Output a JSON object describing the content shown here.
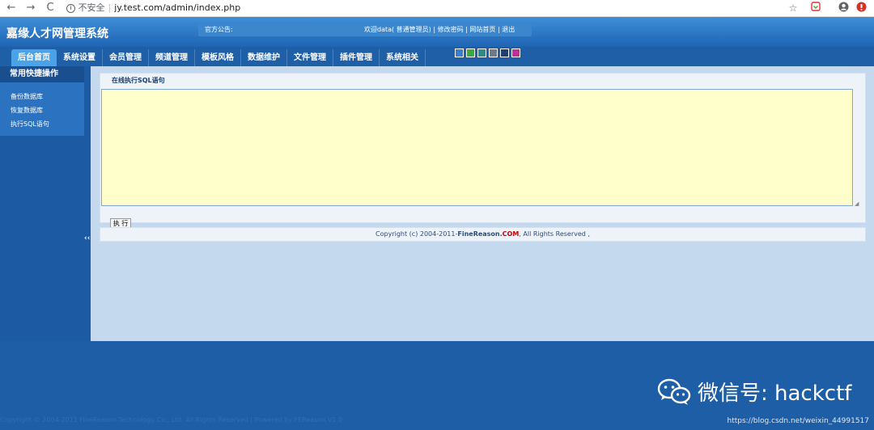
{
  "browser": {
    "back_icon": "←",
    "forward_icon": "→",
    "reload_icon": "C",
    "security_label": "不安全",
    "url": "jy.test.com/admin/index.php"
  },
  "header": {
    "site_title": "嘉缘人才网管理系统",
    "notice_label": "官方公告:",
    "welcome": "欢迎data( 普通管理员)",
    "change_password": "修改密码",
    "site_home": "网站首页",
    "logout": "退出",
    "divider": "|"
  },
  "nav": {
    "tabs": [
      "后台首页",
      "系统设置",
      "会员管理",
      "频道管理",
      "模板风格",
      "数据维护",
      "文件管理",
      "插件管理",
      "系统相关"
    ],
    "swatch_colors": [
      "#3a7ed0",
      "#3aaa3a",
      "#2c8c8c",
      "#6c7a89",
      "#1f3f7a",
      "#c0309a"
    ]
  },
  "sidebar": {
    "heading": "常用快捷操作",
    "items": [
      "备份数据库",
      "恢复数据库",
      "执行SQL语句"
    ],
    "collapse_icon": "‹‹"
  },
  "panel": {
    "title": "在线执行SQL语句",
    "sql_value": "",
    "execute_label": "执 行"
  },
  "copyright": {
    "prefix": "Copyright (c) 2004-2011-",
    "brand": "FineReason",
    "dotcom": ".COM",
    "suffix": ", All Rights Reserved ,"
  },
  "footer": {
    "bottom_copyright": "Copyright © 2004-2011 FineReason Technology Co., Ltd. All Rights Reserved | Powered by FEReason V1.0",
    "wechat_text": "微信号: hackctf",
    "csdn_url": "https://blog.csdn.net/weixin_44991517"
  },
  "colors": {
    "header_top": "#3f8fd8",
    "nav_bg": "#1f5fa8",
    "active_tab": "#4aa3e8",
    "main_bg": "#c5d9ee",
    "textarea_bg": "#ffffcc",
    "brand_com": "#cc0000"
  }
}
